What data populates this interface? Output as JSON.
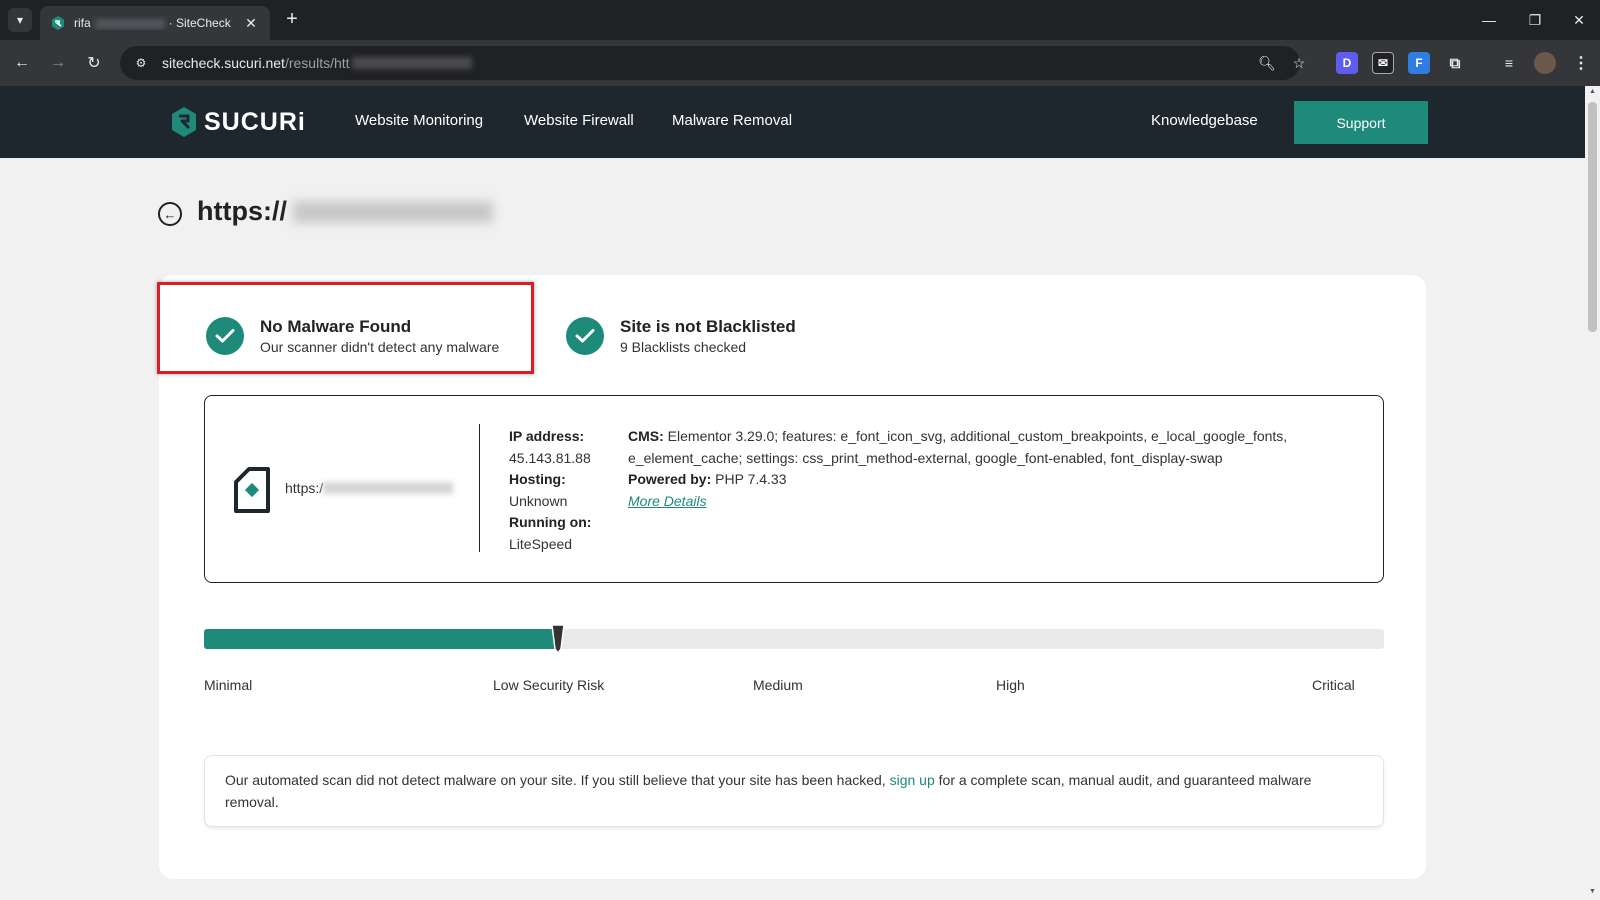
{
  "browser": {
    "tab_title_prefix": "rifa",
    "tab_title_suffix": "· SiteCheck",
    "url_host": "sitecheck.sucuri.net",
    "url_path": "/results/htt"
  },
  "header": {
    "brand": "SUCURi",
    "nav": [
      "Website Monitoring",
      "Website Firewall",
      "Malware Removal"
    ],
    "knowledgebase": "Knowledgebase",
    "support": "Support"
  },
  "page": {
    "url_prefix": "https://"
  },
  "statuses": [
    {
      "title": "No Malware Found",
      "subtitle": "Our scanner didn't detect any malware"
    },
    {
      "title": "Site is not Blacklisted",
      "subtitle": "9 Blacklists checked"
    }
  ],
  "site_info": {
    "url_prefix": "https:/",
    "ip_label": "IP address:",
    "ip_value": "45.143.81.88",
    "hosting_label": "Hosting:",
    "hosting_value": "Unknown",
    "running_label": "Running on:",
    "running_value": "LiteSpeed",
    "cms_label": "CMS:",
    "cms_value": " Elementor 3.29.0; features: e_font_icon_svg, additional_custom_breakpoints, e_local_google_fonts, e_element_cache; settings: css_print_method-external, google_font-enabled, font_display-swap",
    "powered_label": "Powered by:",
    "powered_value": " PHP 7.4.33",
    "more_details": "More Details"
  },
  "risk": {
    "level_fraction": 0.3,
    "labels": [
      "Minimal",
      "Low Security Risk",
      "Medium",
      "High",
      "Critical"
    ]
  },
  "summary": {
    "text_before": "Our automated scan did not detect malware on your site. If you still believe that your site has been hacked, ",
    "link": "sign up",
    "text_after": " for a complete scan, manual audit, and guaranteed malware removal."
  },
  "colors": {
    "accent": "#1d8a7a",
    "header_bg": "#1e272e",
    "highlight": "#d61f26"
  }
}
